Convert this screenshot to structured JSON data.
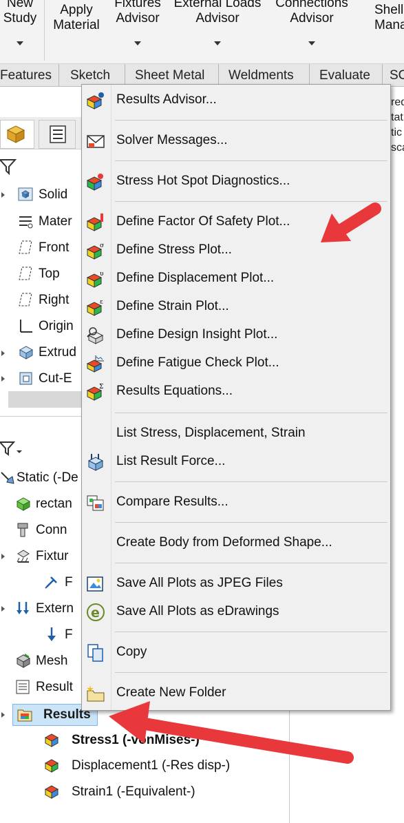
{
  "ribbon": {
    "new_study": "New\nStudy",
    "apply_material": "Apply\nMaterial",
    "fixtures_advisor": "Fixtures\nAdvisor",
    "external_loads_advisor": "External Loads\nAdvisor",
    "connections_advisor": "Connections\nAdvisor",
    "shell_manager": "Shell\nManag"
  },
  "tabs": [
    "Features",
    "Sketch",
    "Sheet Metal",
    "Weldments",
    "Evaluate",
    "SC"
  ],
  "feature_tree": {
    "items": [
      "Solid",
      "Mater",
      "Front",
      "Top",
      "Right",
      "Origin",
      "Extrud",
      "Cut-E"
    ]
  },
  "sim_tree": {
    "static": "Static (-De",
    "items": [
      "rectan",
      "Conn",
      "Fixtur",
      "F",
      "Extern",
      "F",
      "Mesh",
      "Result"
    ],
    "results": "Results",
    "children": [
      "Stress1 (-vonMises-)",
      "Displacement1 (-Res disp-)",
      "Strain1 (-Equivalent-)"
    ]
  },
  "right_pane": [
    "red",
    "tat",
    "tic",
    "sca"
  ],
  "context_menu": {
    "items": [
      {
        "label": "Results Advisor...",
        "icon": "results-advisor-icon"
      },
      {
        "label": "Solver Messages...",
        "icon": "envelope-icon"
      },
      {
        "label": "Stress Hot Spot Diagnostics...",
        "icon": "hot-spot-icon"
      },
      {
        "label": "Define Factor Of Safety Plot...",
        "icon": "fos-plot-icon"
      },
      {
        "label": "Define Stress Plot...",
        "icon": "stress-plot-icon"
      },
      {
        "label": "Define Displacement Plot...",
        "icon": "displacement-plot-icon"
      },
      {
        "label": "Define Strain Plot...",
        "icon": "strain-plot-icon"
      },
      {
        "label": "Define Design Insight Plot...",
        "icon": "design-insight-icon"
      },
      {
        "label": "Define Fatigue Check Plot...",
        "icon": "fatigue-check-icon"
      },
      {
        "label": "Results Equations...",
        "icon": "equations-icon"
      },
      {
        "label": "List Stress, Displacement, Strain",
        "icon": ""
      },
      {
        "label": "List Result Force...",
        "icon": "result-force-icon"
      },
      {
        "label": "Compare Results...",
        "icon": "compare-icon"
      },
      {
        "label": "Create Body from Deformed Shape...",
        "icon": ""
      },
      {
        "label": "Save All Plots as JPEG Files",
        "icon": "jpeg-icon"
      },
      {
        "label": "Save All Plots as eDrawings",
        "icon": "edrawings-icon"
      },
      {
        "label": "Copy",
        "icon": "copy-icon"
      },
      {
        "label": "Create New Folder",
        "icon": "new-folder-icon"
      }
    ]
  },
  "colors": {
    "arrow": "#e8383b",
    "selection": "#cce4f7"
  }
}
